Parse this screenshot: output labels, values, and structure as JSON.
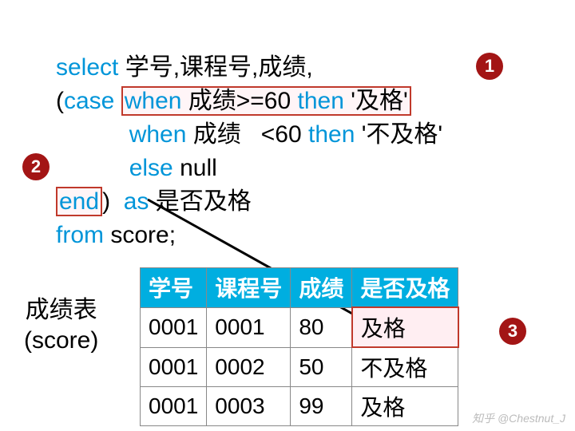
{
  "code": {
    "l1_select": "select",
    "l1_cols": " 学号,课程号,成绩,",
    "l2_open": "(",
    "l2_case": "case",
    "l2_sp": " ",
    "l2_when": "when",
    "l2_cond": " 成绩>=60 ",
    "l2_then": "then",
    "l2_val": " '及格'",
    "l3_when": "when",
    "l3_cond": " 成绩   <60 ",
    "l3_then": "then",
    "l3_val": " '不及格'",
    "l4_else": "else",
    "l4_val": " null",
    "l5_end": "end",
    "l5_close": ")  ",
    "l5_as": "as",
    "l5_alias": " 是否及格",
    "l6_from": "from",
    "l6_tbl": " score;"
  },
  "badges": {
    "one": "1",
    "two": "2",
    "three": "3"
  },
  "score_label": {
    "line1": "成绩表",
    "line2": "(score)"
  },
  "table": {
    "headers": [
      "学号",
      "课程号",
      "成绩",
      "是否及格"
    ],
    "rows": [
      [
        "0001",
        "0001",
        "80",
        "及格"
      ],
      [
        "0001",
        "0002",
        "50",
        "不及格"
      ],
      [
        "0001",
        "0003",
        "99",
        "及格"
      ]
    ]
  },
  "watermark": "知乎 @Chestnut_J"
}
